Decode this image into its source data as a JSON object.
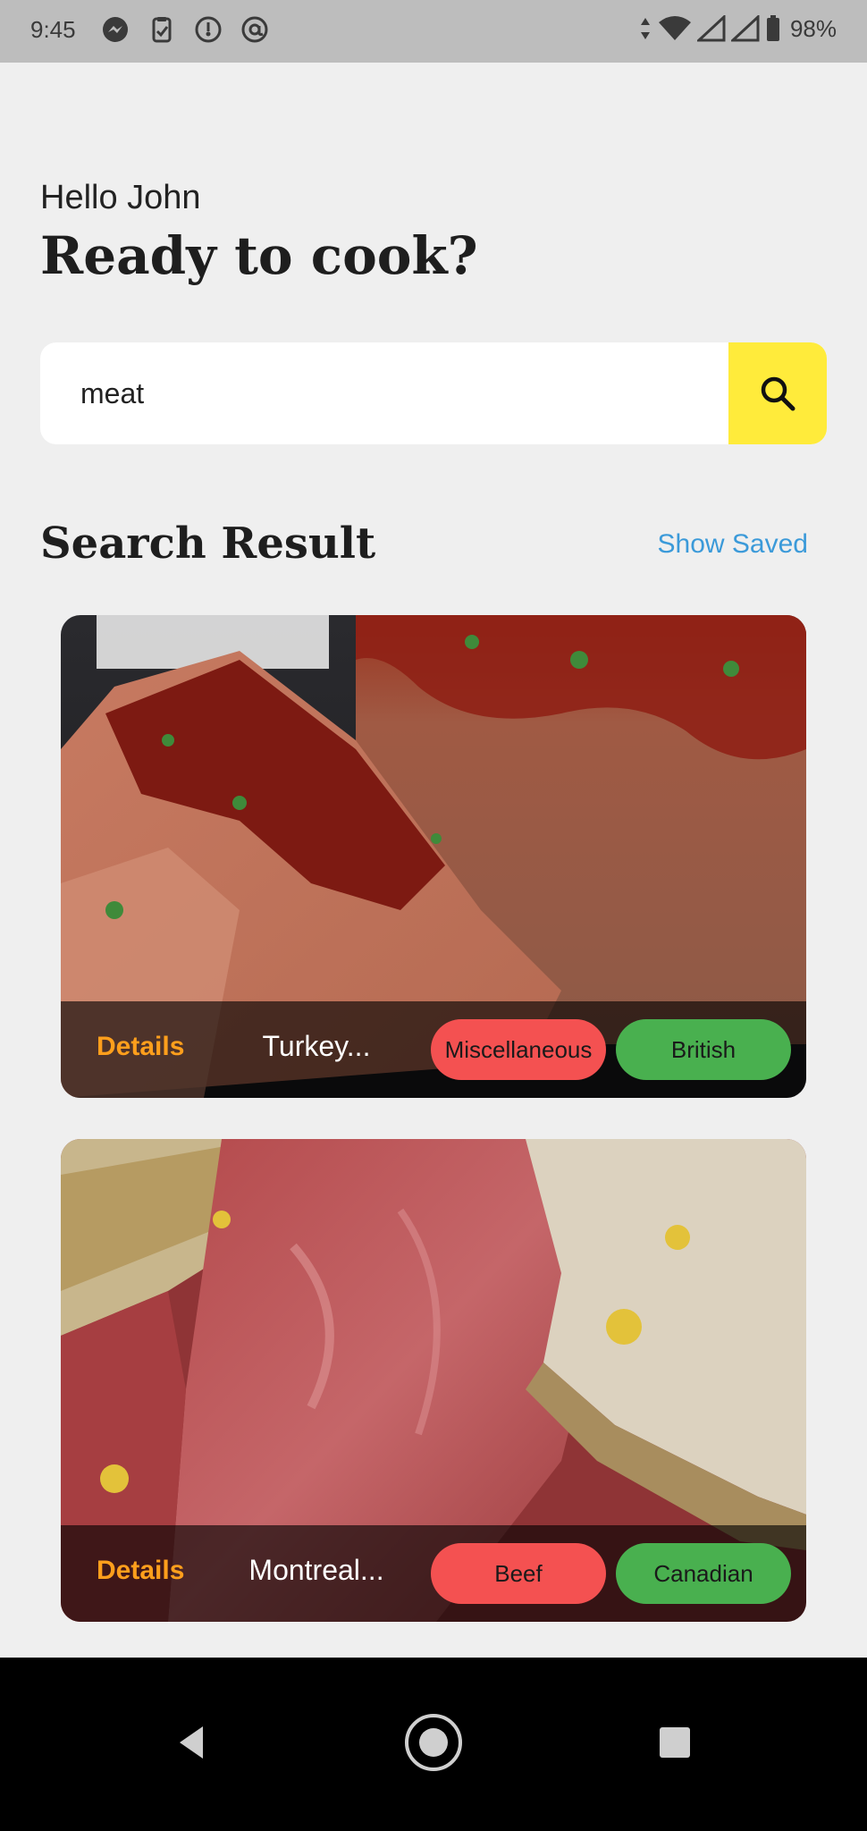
{
  "status_bar": {
    "time": "9:45",
    "battery": "98%",
    "icons": [
      "messenger-icon",
      "clipboard-icon",
      "gauge-icon",
      "at-icon",
      "data-arrows-icon",
      "wifi-icon",
      "signal-icon",
      "signal-icon",
      "battery-icon"
    ]
  },
  "header": {
    "greeting": "Hello John",
    "title": "Ready to cook?"
  },
  "search": {
    "value": "meat",
    "button_icon": "search-icon"
  },
  "results": {
    "title": "Search Result",
    "show_saved": "Show Saved",
    "items": [
      {
        "details_label": "Details",
        "name": "Turkey...",
        "category": "Miscellaneous",
        "area": "British"
      },
      {
        "details_label": "Details",
        "name": "Montreal...",
        "category": "Beef",
        "area": "Canadian"
      }
    ]
  },
  "colors": {
    "accent_yellow": "#ffeb3b",
    "details_orange": "#ff9f1c",
    "category_red": "#f45151",
    "area_green": "#49b04f",
    "link_blue": "#3b9ad9"
  },
  "nav_bar": {
    "icons": [
      "back-icon",
      "home-icon",
      "recent-apps-icon"
    ]
  }
}
